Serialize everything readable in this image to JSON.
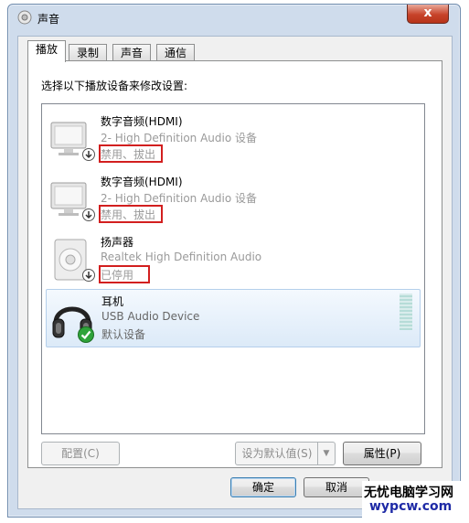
{
  "window": {
    "title": "声音",
    "close_label": "x"
  },
  "tabs": [
    {
      "label": "播放",
      "active": true
    },
    {
      "label": "录制",
      "active": false
    },
    {
      "label": "声音",
      "active": false
    },
    {
      "label": "通信",
      "active": false
    }
  ],
  "panel": {
    "instruction": "选择以下播放设备来修改设置:"
  },
  "devices": [
    {
      "name": "数字音频(HDMI)",
      "description": "2- High Definition Audio 设备",
      "status": "禁用、拔出",
      "icon": "monitor-icon",
      "badge": "down-arrow-badge",
      "selected": false
    },
    {
      "name": "数字音频(HDMI)",
      "description": "2- High Definition Audio 设备",
      "status": "禁用、拔出",
      "icon": "monitor-icon",
      "badge": "down-arrow-badge",
      "selected": false
    },
    {
      "name": "扬声器",
      "description": "Realtek High Definition Audio",
      "status": "已停用",
      "icon": "speaker-icon",
      "badge": "down-arrow-badge",
      "selected": false
    },
    {
      "name": "耳机",
      "description": "USB Audio Device",
      "status": "默认设备",
      "icon": "headphones-icon",
      "badge": "green-check-badge",
      "selected": true
    }
  ],
  "buttons": {
    "configure": "配置(C)",
    "set_default": "设为默认值(S)",
    "properties": "属性(P)",
    "ok": "确定",
    "cancel": "取消"
  },
  "watermark": {
    "line1": "无忧电脑学习网",
    "line2": "wypcw.com"
  },
  "colors": {
    "highlight_box": "#d21f1f",
    "selected_bg": "#dceaf8",
    "title_bg": "#cfdcec"
  }
}
